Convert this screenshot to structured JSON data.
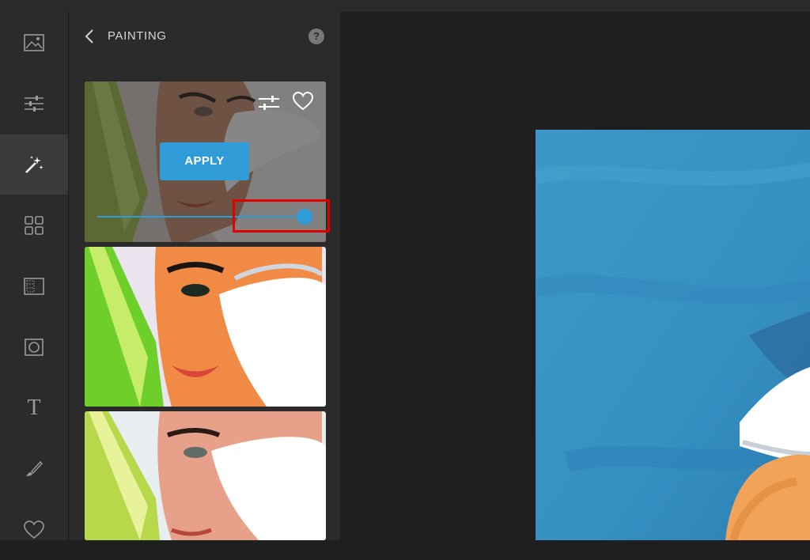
{
  "panel": {
    "title": "PAINTING",
    "help_label": "?"
  },
  "rail": {
    "items": [
      {
        "icon": "image-icon"
      },
      {
        "icon": "sliders-icon"
      },
      {
        "icon": "magic-wand-icon",
        "active": true
      },
      {
        "icon": "grid-icon"
      },
      {
        "icon": "texture-icon"
      },
      {
        "icon": "frame-icon"
      },
      {
        "icon": "text-icon",
        "glyph": "T"
      },
      {
        "icon": "brush-icon"
      },
      {
        "icon": "heart-icon"
      }
    ]
  },
  "filter_preview": {
    "apply_label": "APPLY",
    "intensity": 1.0
  },
  "colors": {
    "accent": "#2f9bd7",
    "highlight": "#e00000"
  }
}
